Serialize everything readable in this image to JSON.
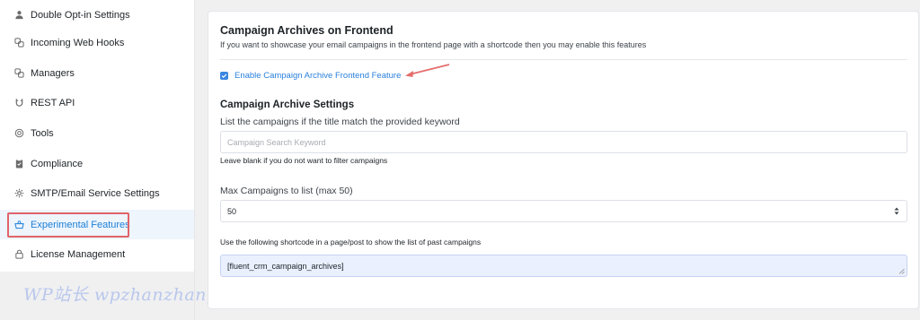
{
  "sidebar": {
    "items": [
      {
        "label": "Double Opt-in Settings",
        "icon": "user-icon"
      },
      {
        "label": "Incoming Web Hooks",
        "icon": "webhook-icon"
      },
      {
        "label": "Managers",
        "icon": "managers-icon"
      },
      {
        "label": "REST API",
        "icon": "magnet-icon"
      },
      {
        "label": "Tools",
        "icon": "tools-icon"
      },
      {
        "label": "Compliance",
        "icon": "clipboard-icon"
      },
      {
        "label": "SMTP/Email Service Settings",
        "icon": "gear-icon"
      },
      {
        "label": "Experimental Features",
        "icon": "basket-icon",
        "active": true
      },
      {
        "label": "License Management",
        "icon": "lock-icon"
      }
    ]
  },
  "watermark": "WP站长 wpzhanzhang.eastfu.com",
  "panel": {
    "title": "Campaign Archives on Frontend",
    "description": "If you want to showcase your email campaigns in the frontend page with a shortcode then you may enable this features",
    "checkbox_label": "Enable Campaign Archive Frontend Feature",
    "checkbox_checked": true,
    "settings_title": "Campaign Archive Settings",
    "keyword_label": "List the campaigns if the title match the provided keyword",
    "keyword_placeholder": "Campaign Search Keyword",
    "keyword_help": "Leave blank if you do not want to filter campaigns",
    "max_label": "Max Campaigns to list (max 50)",
    "max_value": "50",
    "shortcode_help": "Use the following shortcode in a page/post to show the list of past campaigns",
    "shortcode_value": "[fluent_crm_campaign_archives]"
  },
  "colors": {
    "accent": "#2a80dc",
    "active_bg": "#eef5fd",
    "highlight_outline": "#e0636a"
  }
}
